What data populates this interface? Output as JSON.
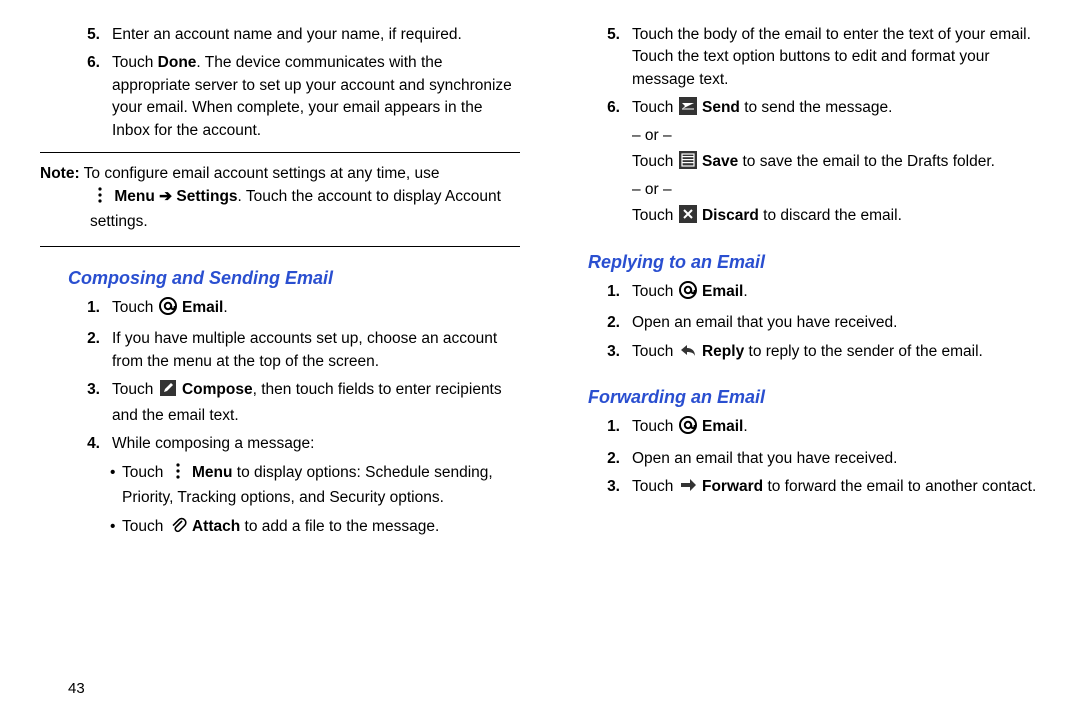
{
  "page_number": "43",
  "left": {
    "steps_top": {
      "item5": {
        "num": "5.",
        "text": "Enter an account name and your name, if required."
      },
      "item6": {
        "num": "6.",
        "pre": "Touch ",
        "bold": "Done",
        "post": ". The device communicates with the appropriate server to set up your account and synchronize your email. When complete, your email appears in the Inbox for the account."
      }
    },
    "note": {
      "label": "Note:",
      "line1": " To configure email account settings at any time, use",
      "line2_pre": "",
      "line2_menu": "Menu",
      "line2_arrow": " ➔ ",
      "line2_settings": "Settings",
      "line2_post": ". Touch the account to display Account settings."
    },
    "heading_compose": "Composing and Sending Email",
    "compose": {
      "item1": {
        "num": "1.",
        "pre": "Touch ",
        "bold": "Email",
        "post": "."
      },
      "item2": {
        "num": "2.",
        "text": "If you have multiple accounts set up, choose an account from the menu at the top of the screen."
      },
      "item3": {
        "num": "3.",
        "pre": "Touch ",
        "bold": "Compose",
        "post": ", then touch fields to enter recipients and the email text."
      },
      "item4": {
        "num": "4.",
        "text": "While composing a message:"
      },
      "bullet1": {
        "pre": "Touch ",
        "bold": "Menu",
        "post": " to display options: Schedule sending, Priority, Tracking options, and Security options."
      },
      "bullet2": {
        "pre": "Touch ",
        "bold": "Attach",
        "post": " to add a file to the message."
      }
    }
  },
  "right": {
    "steps_top": {
      "item5": {
        "num": "5.",
        "text": "Touch the body of the email to enter the text of your email. Touch the text option buttons to edit and format your message text."
      },
      "item6": {
        "num": "6.",
        "line1_pre": "Touch ",
        "line1_bold": "Send",
        "line1_post": " to send the message.",
        "or1": "– or –",
        "line2_pre": "Touch ",
        "line2_bold": "Save",
        "line2_post": " to save the email to the Drafts folder.",
        "or2": "– or –",
        "line3_pre": "Touch ",
        "line3_bold": "Discard",
        "line3_post": " to discard the email."
      }
    },
    "heading_reply": "Replying to an Email",
    "reply": {
      "item1": {
        "num": "1.",
        "pre": "Touch ",
        "bold": "Email",
        "post": "."
      },
      "item2": {
        "num": "2.",
        "text": "Open an email that you have received."
      },
      "item3": {
        "num": "3.",
        "pre": "Touch ",
        "bold": "Reply",
        "post": " to reply to the sender of the email."
      }
    },
    "heading_forward": "Forwarding an Email",
    "forward": {
      "item1": {
        "num": "1.",
        "pre": "Touch ",
        "bold": "Email",
        "post": "."
      },
      "item2": {
        "num": "2.",
        "text": "Open an email that you have received."
      },
      "item3": {
        "num": "3.",
        "pre": "Touch ",
        "bold": "Forward",
        "post": " to forward the email to another contact."
      }
    }
  }
}
